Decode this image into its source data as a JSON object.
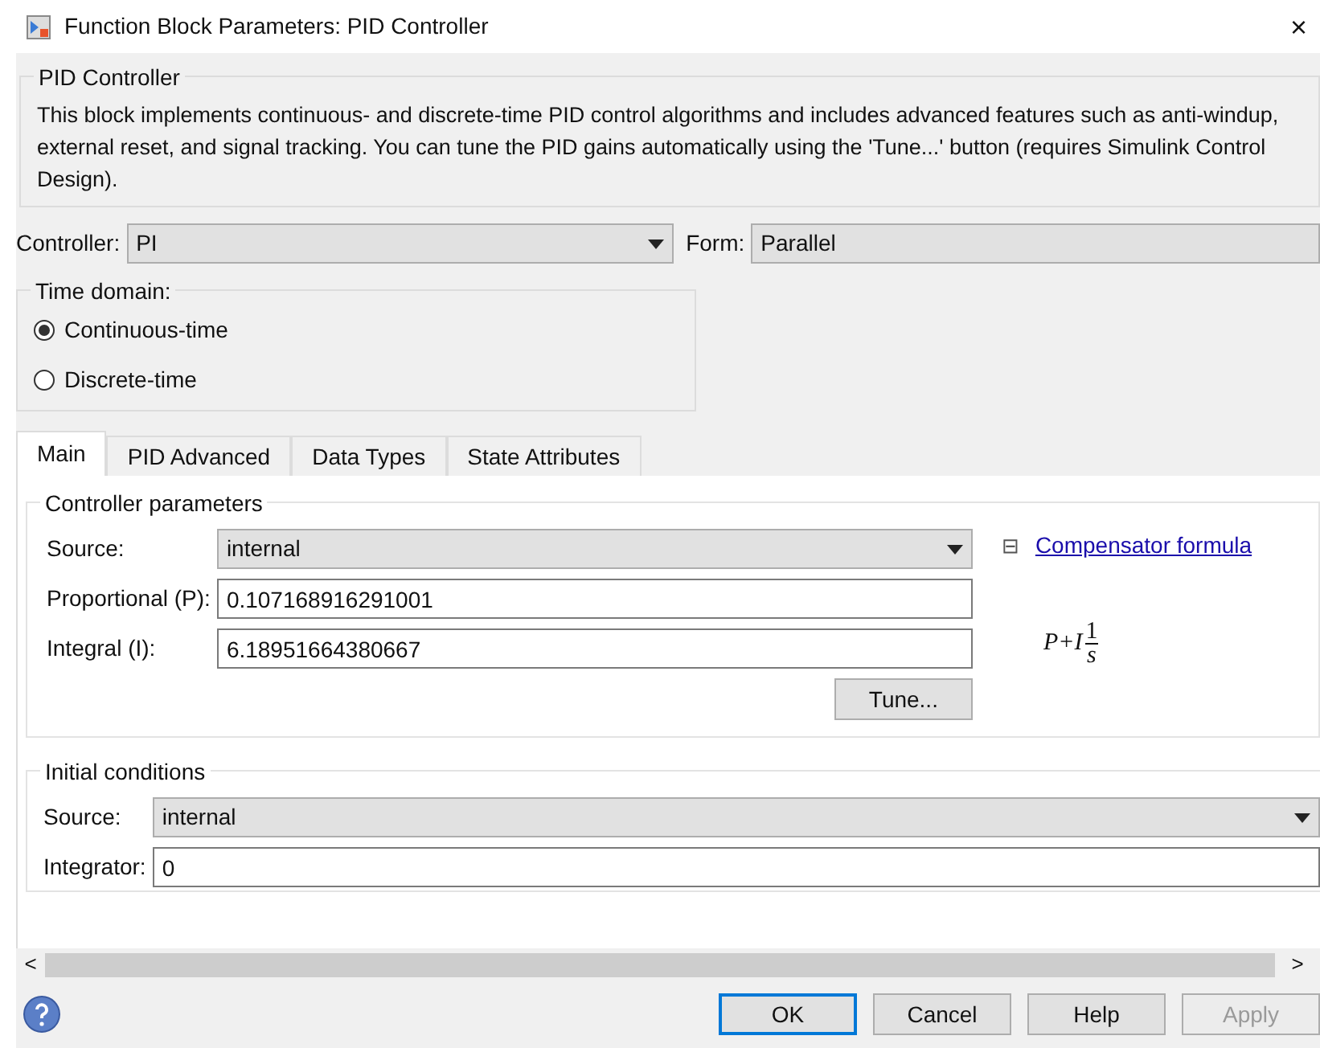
{
  "window": {
    "title": "Function Block Parameters: PID Controller",
    "close": "×"
  },
  "block": {
    "title": "PID Controller",
    "description": "This block implements continuous- and discrete-time PID control algorithms and includes advanced features such as anti-windup, external reset, and signal tracking. You can tune the PID gains automatically using the 'Tune...' button (requires Simulink Control Design)."
  },
  "controller": {
    "label": "Controller:",
    "value": "PI"
  },
  "form": {
    "label": "Form:",
    "value": "Parallel"
  },
  "time_domain": {
    "title": "Time domain:",
    "options": [
      {
        "label": "Continuous-time",
        "selected": true
      },
      {
        "label": "Discrete-time",
        "selected": false
      }
    ]
  },
  "tabs": [
    {
      "label": "Main",
      "selected": true
    },
    {
      "label": "PID Advanced",
      "selected": false
    },
    {
      "label": "Data Types",
      "selected": false
    },
    {
      "label": "State Attributes",
      "selected": false
    }
  ],
  "controller_parameters": {
    "title": "Controller parameters",
    "source_label": "Source:",
    "source_value": "internal",
    "proportional_label": "Proportional (P):",
    "proportional_value": "0.107168916291001",
    "integral_label": "Integral (I):",
    "integral_value": "6.18951664380667",
    "tune": "Tune...",
    "collapse": "⊟",
    "formula_link": "Compensator formula",
    "formula": {
      "lhs": "P+I",
      "numerator": "1",
      "denominator": "s"
    }
  },
  "initial_conditions": {
    "title": "Initial conditions",
    "source_label": "Source:",
    "source_value": "internal",
    "integrator_label": "Integrator:",
    "integrator_value": "0"
  },
  "scroll": {
    "left": "<",
    "right": ">"
  },
  "buttons": [
    {
      "label": "OK",
      "default": true,
      "disabled": false
    },
    {
      "label": "Cancel",
      "default": false,
      "disabled": false
    },
    {
      "label": "Help",
      "default": false,
      "disabled": false
    },
    {
      "label": "Apply",
      "default": false,
      "disabled": true
    }
  ]
}
